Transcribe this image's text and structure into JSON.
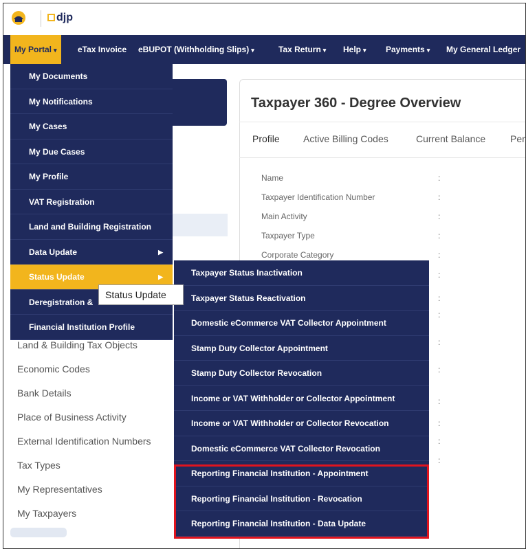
{
  "header": {
    "logo_text": "djp"
  },
  "nav": {
    "items": [
      {
        "label": "My Portal",
        "has_caret": true
      },
      {
        "label": "eTax Invoice",
        "has_caret": false
      },
      {
        "label": "eBUPOT (Withholding Slips)",
        "has_caret": true
      },
      {
        "label": "Tax Return",
        "has_caret": true
      },
      {
        "label": "Help",
        "has_caret": true
      },
      {
        "label": "Payments",
        "has_caret": true
      },
      {
        "label": "My General Ledger",
        "has_caret": false
      }
    ],
    "caret_symbol": "▾"
  },
  "portal_menu": [
    {
      "label": "My Documents"
    },
    {
      "label": "My Notifications"
    },
    {
      "label": "My Cases"
    },
    {
      "label": "My Due Cases"
    },
    {
      "label": "My Profile"
    },
    {
      "label": "VAT Registration"
    },
    {
      "label": "Land and Building Registration"
    },
    {
      "label": "Data Update"
    },
    {
      "label": "Status Update"
    },
    {
      "label": "Deregistration &"
    },
    {
      "label": "Financial Institution Profile"
    }
  ],
  "status_submenu": [
    "Taxpayer Status Inactivation",
    "Taxpayer Status Reactivation",
    "Domestic eCommerce VAT Collector Appointment",
    "Stamp Duty Collector Appointment",
    "Stamp Duty Collector Revocation",
    "Income or VAT Withholder or Collector Appointment",
    "Income or VAT Withholder or Collector Revocation",
    "Domestic eCommerce VAT Collector Revocation",
    "Reporting Financial Institution - Appointment",
    "Reporting Financial Institution - Revocation",
    "Reporting Financial Institution - Data Update"
  ],
  "tooltip": "Status Update",
  "left_menu": [
    "Land & Building Tax Objects",
    "Economic Codes",
    "Bank Details",
    "Place of Business Activity",
    "External Identification Numbers",
    "Tax Types",
    "My Representatives",
    "My Taxpayers"
  ],
  "main": {
    "title": "Taxpayer 360 - Degree Overview",
    "tabs": [
      "Profile",
      "Active Billing Codes",
      "Current Balance",
      "Pen"
    ],
    "fields": [
      "Name",
      "Taxpayer Identification Number",
      "Main Activity",
      "Taxpayer Type",
      "Corporate Category"
    ],
    "colon": ":"
  },
  "colors": {
    "navy": "#1f2a5c",
    "accent": "#f2b51d",
    "highlight_border": "#e0141e"
  }
}
